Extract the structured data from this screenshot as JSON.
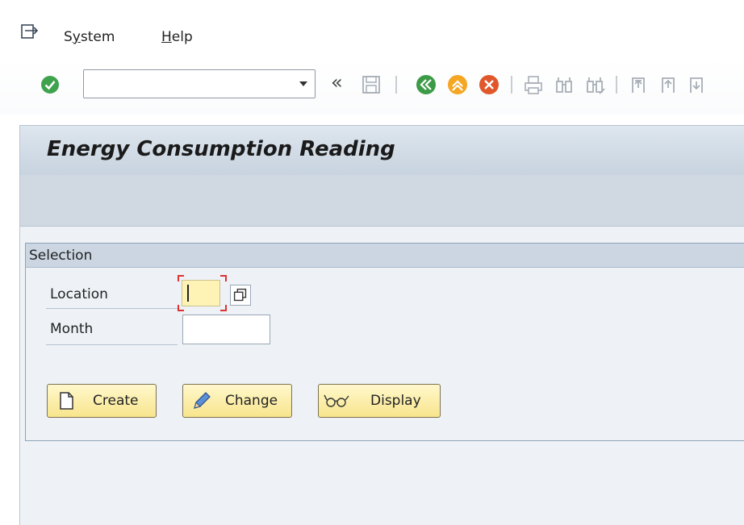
{
  "menu": {
    "items": [
      {
        "label": "System",
        "mnemonic": "y"
      },
      {
        "label": "Help",
        "mnemonic": "H"
      }
    ]
  },
  "toolbar": {
    "command_field": {
      "value": ""
    },
    "icons": [
      "enter-icon",
      "collapse-toolbar-icon",
      "save-icon",
      "back-icon",
      "exit-icon",
      "cancel-icon",
      "print-icon",
      "find-icon",
      "find-next-icon",
      "first-page-icon",
      "previous-page-icon"
    ]
  },
  "title": "Energy Consumption Reading",
  "selection": {
    "group_title": "Selection",
    "location": {
      "label": "Location",
      "value": ""
    },
    "month": {
      "label": "Month",
      "value": ""
    }
  },
  "buttons": {
    "create": "Create",
    "change": "Change",
    "display": "Display"
  },
  "colors": {
    "button_bg": "#f8e58c",
    "title_bar": "#c7d3df",
    "focus_field": "#fff2b5",
    "focus_corner": "#dd3333"
  }
}
